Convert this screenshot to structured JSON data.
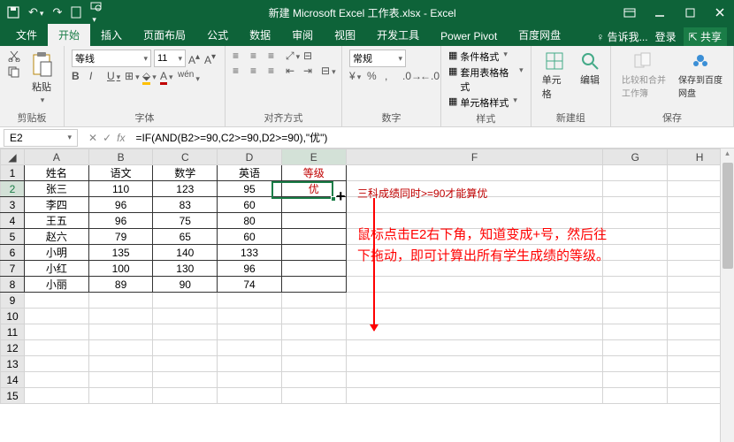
{
  "titlebar": {
    "title": "新建 Microsoft Excel 工作表.xlsx - Excel"
  },
  "tabs": {
    "items": [
      "文件",
      "开始",
      "插入",
      "页面布局",
      "公式",
      "数据",
      "审阅",
      "视图",
      "开发工具",
      "Power Pivot",
      "百度网盘"
    ],
    "active_index": 1,
    "tell_me": "告诉我...",
    "login": "登录",
    "share": "共享"
  },
  "ribbon": {
    "clipboard": {
      "label": "剪贴板",
      "paste": "粘贴"
    },
    "font": {
      "label": "字体",
      "name": "等线",
      "size": "11"
    },
    "align": {
      "label": "对齐方式"
    },
    "number": {
      "label": "数字",
      "format": "常规"
    },
    "styles": {
      "label": "样式",
      "cond": "条件格式",
      "table": "套用表格格式",
      "cell": "单元格样式"
    },
    "cells": {
      "label": "新建组",
      "cellbtn": "单元格",
      "editbtn": "编辑"
    },
    "compare": {
      "label": "保存",
      "btn1": "比较和合并工作簿",
      "btn2": "保存到百度网盘"
    }
  },
  "namebox": {
    "ref": "E2",
    "formula": "=IF(AND(B2>=90,C2>=90,D2>=90),\"优\")"
  },
  "chart_data": {
    "type": "table",
    "headers": [
      "姓名",
      "语文",
      "数学",
      "英语",
      "等级"
    ],
    "rows": [
      [
        "张三",
        "110",
        "123",
        "95",
        "优"
      ],
      [
        "李四",
        "96",
        "83",
        "60",
        ""
      ],
      [
        "王五",
        "96",
        "75",
        "80",
        ""
      ],
      [
        "赵六",
        "79",
        "65",
        "60",
        ""
      ],
      [
        "小明",
        "135",
        "140",
        "133",
        ""
      ],
      [
        "小红",
        "100",
        "130",
        "96",
        ""
      ],
      [
        "小丽",
        "89",
        "90",
        "74",
        ""
      ]
    ]
  },
  "cols": [
    "A",
    "B",
    "C",
    "D",
    "E",
    "F",
    "G",
    "H"
  ],
  "annotations": {
    "note1": "三科成绩同时>=90才能算优",
    "note2_line1": "鼠标点击E2右下角，知道变成+号，然后往",
    "note2_line2": "下拖动，即可计算出所有学生成绩的等级。"
  }
}
